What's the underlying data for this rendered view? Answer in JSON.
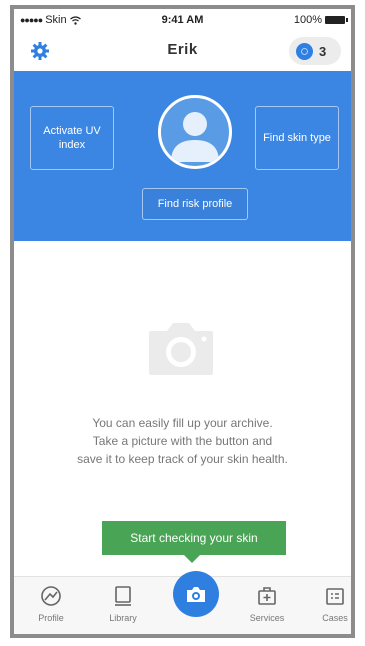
{
  "status_bar": {
    "carrier": "Skin",
    "time": "9:41 AM",
    "battery": "100%"
  },
  "nav": {
    "title": "Erik",
    "badge_count": "3"
  },
  "hero": {
    "activate_uv": "Activate UV index",
    "find_skin_type": "Find skin type",
    "find_risk_profile": "Find risk profile"
  },
  "empty_state": {
    "lines": [
      "You can easily fill up your archive.",
      "Take a picture with the button and",
      "save it to keep track of your skin health."
    ]
  },
  "cta": {
    "label": "Start checking your skin"
  },
  "tabs": {
    "profile": "Profile",
    "library": "Library",
    "services": "Services",
    "cases": "Cases"
  },
  "colors": {
    "primary_blue": "#3b86e3",
    "accent_green": "#4aa456"
  },
  "icons": {
    "settings": "gear-icon",
    "camera": "camera-icon"
  }
}
